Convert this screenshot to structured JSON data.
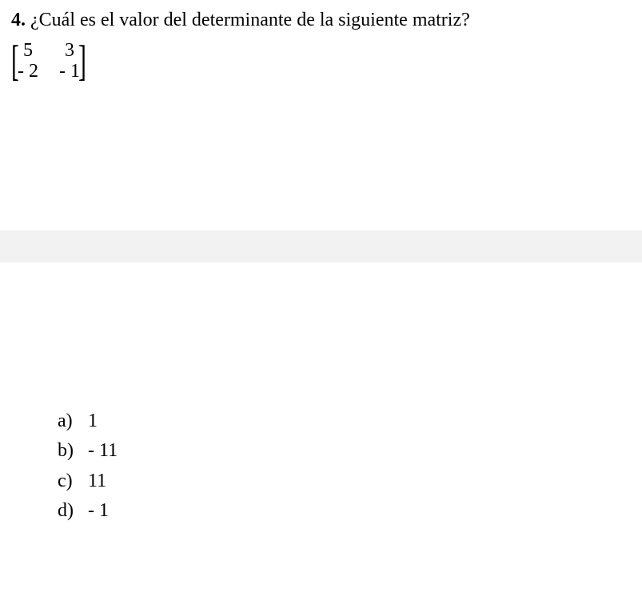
{
  "question": {
    "number": "4.",
    "text": "¿Cuál es el valor del determinante de la siguiente matriz?"
  },
  "matrix": {
    "a11": "5",
    "a12": "3",
    "a21": "- 2",
    "a22": "- 1"
  },
  "options": [
    {
      "label": "a)",
      "value": "1"
    },
    {
      "label": "b)",
      "value": "- 11"
    },
    {
      "label": "c)",
      "value": "11"
    },
    {
      "label": "d)",
      "value": "- 1"
    }
  ]
}
